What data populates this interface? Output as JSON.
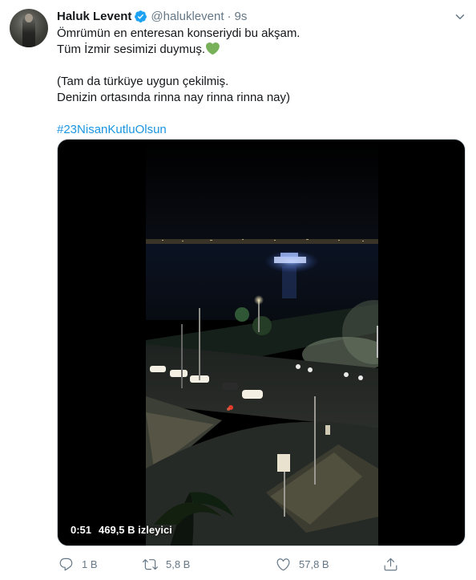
{
  "tweet": {
    "author": {
      "display_name": "Haluk Levent",
      "handle": "@haluklevent",
      "verified": true
    },
    "timestamp": "9s",
    "text_lines": [
      "Ömrümün en enteresan konseriydi bu akşam.",
      "Tüm İzmir sesimizi duymuş.",
      "(Tam da türküye uygun çekilmiş.",
      "Denizin ortasında rinna nay rinna rinna nay)"
    ],
    "emoji": "green-heart",
    "hashtag": "#23NisanKutluOlsun",
    "video": {
      "duration": "0:51",
      "views": "469,5 B izleyici"
    },
    "actions": {
      "reply_count": "1 B",
      "retweet_count": "5,8 B",
      "like_count": "57,8 B"
    }
  },
  "icons": [
    "verified-badge-icon",
    "chevron-down-icon",
    "reply-icon",
    "retweet-icon",
    "like-icon",
    "share-icon"
  ],
  "colors": {
    "accent": "#1da1f2",
    "hashtag": "#1b95e0",
    "secondary_text": "#657786",
    "primary_text": "#14171a",
    "heart_emoji": "#78b159"
  }
}
